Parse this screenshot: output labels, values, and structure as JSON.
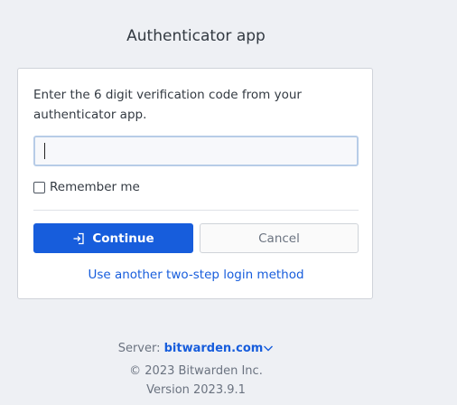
{
  "page": {
    "title": "Authenticator app"
  },
  "form": {
    "instructions": "Enter the 6 digit verification code from your authenticator app.",
    "code_value": "",
    "code_placeholder": "",
    "remember_label": "Remember me",
    "remember_checked": false,
    "continue_label": "Continue",
    "cancel_label": "Cancel",
    "alt_method_link": "Use another two-step login method"
  },
  "footer": {
    "server_label": "Server:",
    "server_value": "bitwarden.com",
    "copyright": "© 2023 Bitwarden Inc.",
    "version": "Version 2023.9.1"
  },
  "icons": {
    "continue": "sign-in-icon",
    "server_dropdown": "chevron-down-icon"
  },
  "colors": {
    "accent": "#175ddc",
    "background": "#eef0f4",
    "card": "#ffffff",
    "input_border": "#b7cce7"
  }
}
